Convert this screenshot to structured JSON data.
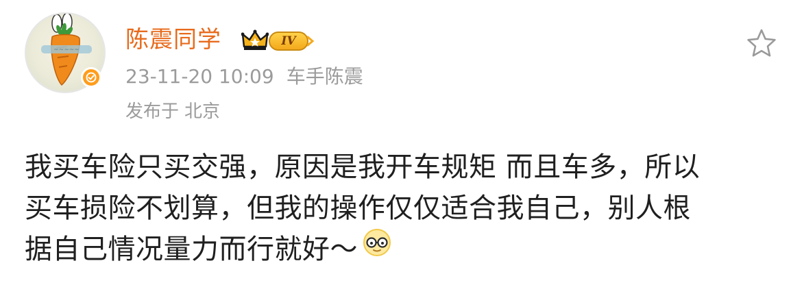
{
  "user": {
    "name": "陈震同学",
    "level": "IV",
    "verified": true
  },
  "post": {
    "timestamp": "23-11-20 10:09",
    "source": "车手陈震",
    "location_prefix": "发布于",
    "location": "北京",
    "lines": [
      "我买车险只买交强，原因是我开车规矩 而且车多，所以",
      "买车损险不划算，但我的操作仅仅适合我自己，别人根",
      "据自己情况量力而行就好～"
    ]
  },
  "icons": {
    "favorite": "star-outline-icon",
    "verified": "verified-badge-icon",
    "crown": "crown-icon",
    "emoji": "nerd-glasses-emoji-icon"
  },
  "colors": {
    "username": "#e86b1c",
    "meta": "#9b9b9b",
    "body_text": "#1f1f1f",
    "verified_badge": "#ff9d1c",
    "level_badge": "#f4a91c"
  }
}
